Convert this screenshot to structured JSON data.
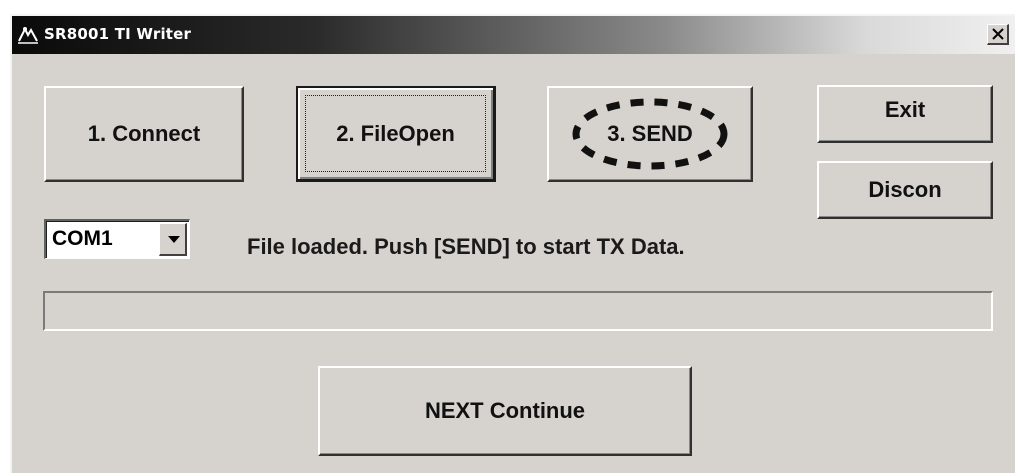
{
  "window": {
    "title": "SR8001 TI Writer",
    "icon": "app-icon",
    "close_label": "close"
  },
  "buttons": {
    "connect": "1. Connect",
    "fileopen": "2. FileOpen",
    "send": "3. SEND",
    "exit": "Exit",
    "discon": "Discon",
    "next": "NEXT Continue"
  },
  "port": {
    "selected": "COM1"
  },
  "status": {
    "message": "File loaded. Push [SEND] to start TX Data."
  },
  "progress": {
    "value_percent": 0
  },
  "annotation": {
    "send_highlight": "dashed-ellipse"
  }
}
